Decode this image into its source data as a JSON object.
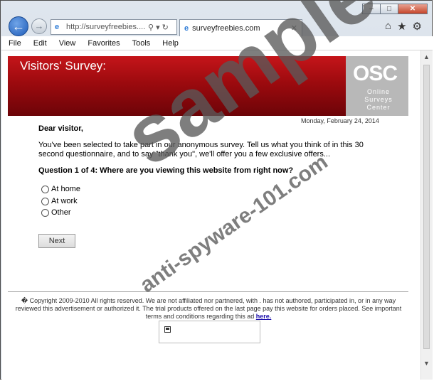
{
  "browser": {
    "window_controls": [
      "–",
      "□",
      "✕"
    ],
    "address": "http://surveyfreebies....",
    "tab_title": "surveyfreebies.com",
    "menu": [
      "File",
      "Edit",
      "View",
      "Favorites",
      "Tools",
      "Help"
    ]
  },
  "page": {
    "banner_title": "Visitors' Survey:",
    "logo": {
      "abbr": "OSC",
      "subtitle": "Online Surveys Center"
    },
    "date": "Monday, February 24, 2014",
    "greeting": "Dear visitor,",
    "intro": "You've been selected to take part in our anonymous survey. Tell us what you think of in this 30 second questionnaire, and to say \"thank you\", we'll offer you a few exclusive offers...",
    "question": "Question 1 of 4: Where are you viewing this website from right now?",
    "options": [
      "At home",
      "At work",
      "Other"
    ],
    "next_button": "Next",
    "footer_text": "� Copyright 2009-2010 All rights reserved. We are not affiliated nor partnered, with . has not authored, participated in, or in any way reviewed this advertisement or authorized it. The trial products offered on the last page pay this website for orders placed. See important terms and conditions regarding this ad",
    "footer_link": "here."
  },
  "watermark": {
    "main": "sample",
    "sub": "anti-spyware-101.com"
  }
}
